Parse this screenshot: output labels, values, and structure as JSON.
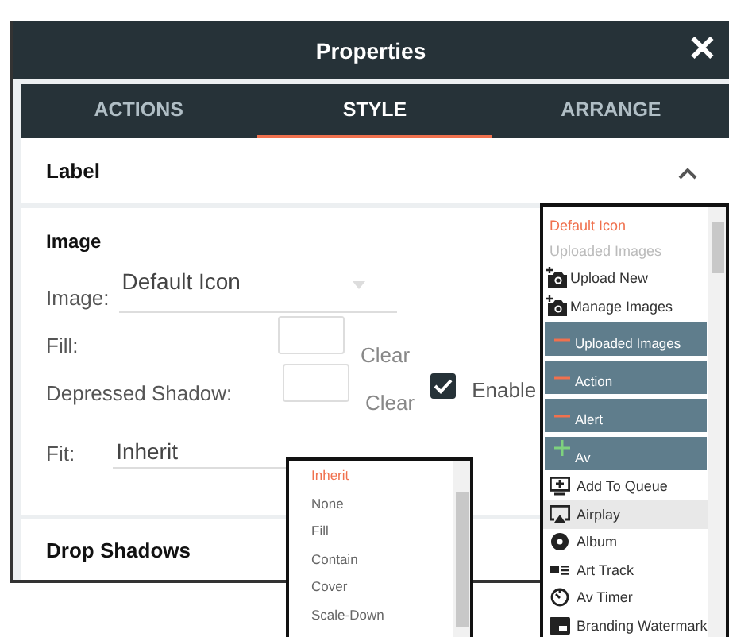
{
  "window": {
    "title": "Properties",
    "close": "✕"
  },
  "tabs": [
    {
      "label": "ACTIONS",
      "selected": false
    },
    {
      "label": "STYLE",
      "selected": true
    },
    {
      "label": "ARRANGE",
      "selected": false
    }
  ],
  "label_section": {
    "title": "Label",
    "expanded": true
  },
  "image_section": {
    "title": "Image",
    "fields": [
      {
        "kind": "select",
        "label": "Image:",
        "value": "Default Icon"
      },
      {
        "kind": "color",
        "label": "Fill:",
        "clear": "Clear"
      },
      {
        "kind": "color",
        "label": "Depressed Shadow:",
        "clear": "Clear",
        "checkbox": {
          "checked": true,
          "label": "Enable"
        }
      },
      {
        "kind": "select",
        "label": "Fit:",
        "value": "Inherit"
      }
    ]
  },
  "drop_shadows": {
    "title": "Drop Shadows"
  },
  "icon_menu": {
    "items": [
      {
        "kind": "option",
        "label": "Default Icon",
        "selected": true
      },
      {
        "kind": "header",
        "label": "Uploaded Images"
      },
      {
        "kind": "action",
        "label": "Upload New"
      },
      {
        "kind": "action",
        "label": "Manage Images"
      },
      {
        "kind": "group",
        "label": "Uploaded Images",
        "expanded": true
      },
      {
        "kind": "group",
        "label": "Action",
        "expanded": true
      },
      {
        "kind": "group",
        "label": "Alert",
        "expanded": true
      },
      {
        "kind": "group",
        "label": "Av",
        "expanded": false
      },
      {
        "kind": "option",
        "label": "Add To Queue",
        "selected": false
      },
      {
        "kind": "option",
        "label": "Airplay",
        "selected": false,
        "hovered": true
      },
      {
        "kind": "option",
        "label": "Album",
        "selected": false
      },
      {
        "kind": "option",
        "label": "Art Track",
        "selected": false
      },
      {
        "kind": "option",
        "label": "Av Timer",
        "selected": false
      },
      {
        "kind": "option",
        "label": "Branding Watermark",
        "selected": false
      }
    ]
  },
  "fit_menu": {
    "items": [
      {
        "label": "Inherit",
        "selected": true
      },
      {
        "label": "None",
        "selected": false
      },
      {
        "label": "Fill",
        "selected": false
      },
      {
        "label": "Contain",
        "selected": false
      },
      {
        "label": "Cover",
        "selected": false
      },
      {
        "label": "Scale-Down",
        "selected": false
      }
    ]
  }
}
